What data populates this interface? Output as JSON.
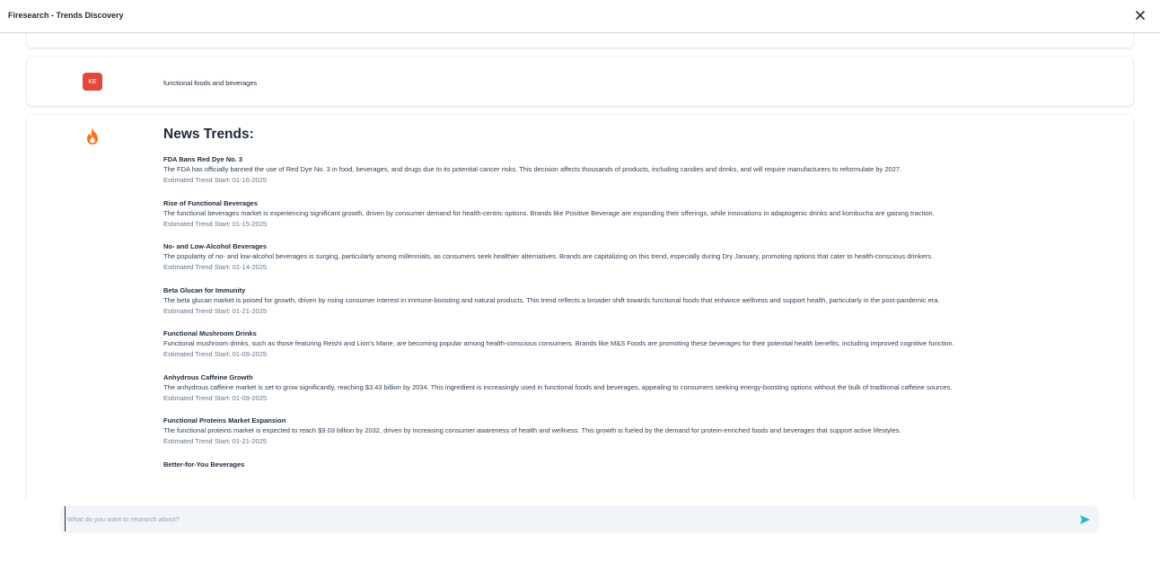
{
  "window": {
    "title": "Firesearch - Trends Discovery",
    "close_icon": "close-icon"
  },
  "user_message": {
    "avatar_initials": "KE",
    "avatar_color": "#e2473b",
    "text": "functional foods and beverages"
  },
  "ai_message": {
    "icon": "flame-icon",
    "accent_color": "#f97316",
    "heading": "News Trends:",
    "trends": [
      {
        "title": "FDA Bans Red Dye No. 3",
        "description": "The FDA has officially banned the use of Red Dye No. 3 in food, beverages, and drugs due to its potential cancer risks. This decision affects thousands of products, including candies and drinks, and will require manufacturers to reformulate by 2027.",
        "date": "Estimated Trend Start: 01-16-2025"
      },
      {
        "title": "Rise of Functional Beverages",
        "description": "The functional beverages market is experiencing significant growth, driven by consumer demand for health-centric options. Brands like Positive Beverage are expanding their offerings, while innovations in adaptogenic drinks and kombucha are gaining traction.",
        "date": "Estimated Trend Start: 01-15-2025"
      },
      {
        "title": "No- and Low-Alcohol Beverages",
        "description": "The popularity of no- and low-alcohol beverages is surging, particularly among millennials, as consumers seek healthier alternatives. Brands are capitalizing on this trend, especially during Dry January, promoting options that cater to health-conscious drinkers.",
        "date": "Estimated Trend Start: 01-14-2025"
      },
      {
        "title": "Beta Glucan for Immunity",
        "description": "The beta glucan market is poised for growth, driven by rising consumer interest in immune-boosting and natural products. This trend reflects a broader shift towards functional foods that enhance wellness and support health, particularly in the post-pandemic era.",
        "date": "Estimated Trend Start: 01-21-2025"
      },
      {
        "title": "Functional Mushroom Drinks",
        "description": "Functional mushroom drinks, such as those featuring Reishi and Lion's Mane, are becoming popular among health-conscious consumers. Brands like M&S Foods are promoting these beverages for their potential health benefits, including improved cognitive function.",
        "date": "Estimated Trend Start: 01-09-2025"
      },
      {
        "title": "Anhydrous Caffeine Growth",
        "description": "The anhydrous caffeine market is set to grow significantly, reaching $3.43 billion by 2034. This ingredient is increasingly used in functional foods and beverages, appealing to consumers seeking energy-boosting options without the bulk of traditional caffeine sources.",
        "date": "Estimated Trend Start: 01-09-2025"
      },
      {
        "title": "Functional Proteins Market Expansion",
        "description": "The functional proteins market is expected to reach $9.03 billion by 2032, driven by increasing consumer awareness of health and wellness. This growth is fueled by the demand for protein-enriched foods and beverages that support active lifestyles.",
        "date": "Estimated Trend Start: 01-21-2025"
      },
      {
        "title": "Better-for-You Beverages",
        "description": "",
        "date": ""
      }
    ]
  },
  "input": {
    "placeholder": "What do you want to research about?",
    "value": "",
    "send_icon": "send-icon",
    "send_color": "#22b8cf"
  }
}
